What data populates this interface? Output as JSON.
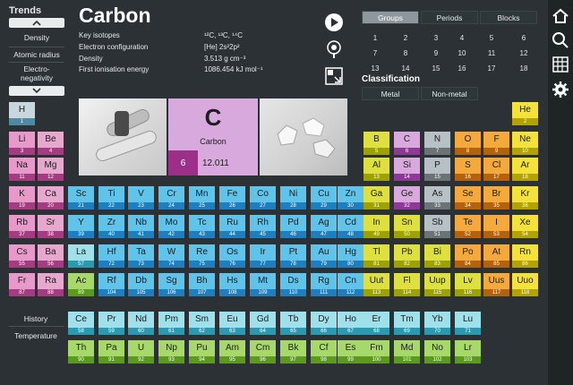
{
  "trends": {
    "title": "Trends",
    "items": [
      "Density",
      "Atomic radius",
      "Electro-\nnegativity"
    ]
  },
  "element": {
    "name": "Carbon",
    "symbol": "C",
    "display_name": "Carbon",
    "number": "6",
    "mass": "12.011",
    "properties": [
      {
        "label": "Key isotopes",
        "value": "¹²C, ¹³C, ¹⁴C"
      },
      {
        "label": "Electron configuration",
        "value": "[He] 2s²2p²"
      },
      {
        "label": "Density",
        "value": "3.513 g cm⁻³"
      },
      {
        "label": "First ionisation energy",
        "value": "1086.454 kJ mol⁻¹"
      }
    ]
  },
  "tabs": [
    "Groups",
    "Periods",
    "Blocks"
  ],
  "group_numbers": [
    "1",
    "2",
    "3",
    "4",
    "5",
    "6",
    "7",
    "8",
    "9",
    "10",
    "11",
    "12",
    "13",
    "14",
    "15",
    "16",
    "17",
    "18"
  ],
  "classification": {
    "title": "Classification",
    "options": [
      "Metal",
      "Non-metal"
    ]
  },
  "bottom_left": [
    "History",
    "Temperature"
  ],
  "colors": {
    "blue": "#5bc0eb",
    "purple": "#d7a9dc",
    "pink": "#e88fbe",
    "yellow": "#e3e34a",
    "lime": "#b4d44a",
    "orange": "#f6a94a",
    "gray": "#b8c0c4",
    "cyan": "#8cd9e6",
    "green": "#a5d86a"
  },
  "elements": [
    {
      "s": "H",
      "n": "1",
      "c": "#c8d6de",
      "b": "#4f8aa5"
    },
    {
      "s": "He",
      "n": "2",
      "c": "#f4e23a",
      "b": "#b2a300"
    },
    {
      "s": "Li",
      "n": "3",
      "c": "#e79ac9",
      "b": "#a33c80"
    },
    {
      "s": "Be",
      "n": "4",
      "c": "#e7a8cd",
      "b": "#a33c80"
    },
    {
      "s": "B",
      "n": "5",
      "c": "#dde03f",
      "b": "#9ea200"
    },
    {
      "s": "C",
      "n": "6",
      "c": "#d7a9dc",
      "b": "#8c3a96"
    },
    {
      "s": "N",
      "n": "7",
      "c": "#b7c0c4",
      "b": "#6b7377"
    },
    {
      "s": "O",
      "n": "8",
      "c": "#f4a93d",
      "b": "#b5620d"
    },
    {
      "s": "F",
      "n": "9",
      "c": "#f4a93d",
      "b": "#b5620d"
    },
    {
      "s": "Ne",
      "n": "10",
      "c": "#f4e23a",
      "b": "#b2a300"
    },
    {
      "s": "Na",
      "n": "11",
      "c": "#e79ac9",
      "b": "#a33c80"
    },
    {
      "s": "Mg",
      "n": "12",
      "c": "#e7a8cd",
      "b": "#a33c80"
    },
    {
      "s": "Al",
      "n": "13",
      "c": "#dde03f",
      "b": "#9ea200"
    },
    {
      "s": "Si",
      "n": "14",
      "c": "#d7a9dc",
      "b": "#8c3a96"
    },
    {
      "s": "P",
      "n": "15",
      "c": "#b7c0c4",
      "b": "#6b7377"
    },
    {
      "s": "S",
      "n": "16",
      "c": "#f4a93d",
      "b": "#b5620d"
    },
    {
      "s": "Cl",
      "n": "17",
      "c": "#f4a93d",
      "b": "#b5620d"
    },
    {
      "s": "Ar",
      "n": "18",
      "c": "#f4e23a",
      "b": "#b2a300"
    },
    {
      "s": "K",
      "n": "19",
      "c": "#e79ac9",
      "b": "#a33c80"
    },
    {
      "s": "Ca",
      "n": "20",
      "c": "#e7a8cd",
      "b": "#a33c80"
    },
    {
      "s": "Sc",
      "n": "21",
      "c": "#5fc3ea",
      "b": "#1d7fbf"
    },
    {
      "s": "Ti",
      "n": "22",
      "c": "#5fc3ea",
      "b": "#1d7fbf"
    },
    {
      "s": "V",
      "n": "23",
      "c": "#5fc3ea",
      "b": "#1d7fbf"
    },
    {
      "s": "Cr",
      "n": "24",
      "c": "#5fc3ea",
      "b": "#1d7fbf"
    },
    {
      "s": "Mn",
      "n": "25",
      "c": "#5fc3ea",
      "b": "#1d7fbf"
    },
    {
      "s": "Fe",
      "n": "26",
      "c": "#5fc3ea",
      "b": "#1d7fbf"
    },
    {
      "s": "Co",
      "n": "27",
      "c": "#5fc3ea",
      "b": "#1d7fbf"
    },
    {
      "s": "Ni",
      "n": "28",
      "c": "#5fc3ea",
      "b": "#1d7fbf"
    },
    {
      "s": "Cu",
      "n": "29",
      "c": "#5fc3ea",
      "b": "#1d7fbf"
    },
    {
      "s": "Zn",
      "n": "30",
      "c": "#5fc3ea",
      "b": "#1d7fbf"
    },
    {
      "s": "Ga",
      "n": "31",
      "c": "#dde03f",
      "b": "#9ea200"
    },
    {
      "s": "Ge",
      "n": "32",
      "c": "#d7a9dc",
      "b": "#8c3a96"
    },
    {
      "s": "As",
      "n": "33",
      "c": "#b7c0c4",
      "b": "#6b7377"
    },
    {
      "s": "Se",
      "n": "34",
      "c": "#f4a93d",
      "b": "#b5620d"
    },
    {
      "s": "Br",
      "n": "35",
      "c": "#f4a93d",
      "b": "#b5620d"
    },
    {
      "s": "Kr",
      "n": "36",
      "c": "#f4e23a",
      "b": "#b2a300"
    },
    {
      "s": "Rb",
      "n": "37",
      "c": "#e79ac9",
      "b": "#a33c80"
    },
    {
      "s": "Sr",
      "n": "38",
      "c": "#e7a8cd",
      "b": "#a33c80"
    },
    {
      "s": "Y",
      "n": "39",
      "c": "#5fc3ea",
      "b": "#1d7fbf"
    },
    {
      "s": "Zr",
      "n": "40",
      "c": "#5fc3ea",
      "b": "#1d7fbf"
    },
    {
      "s": "Nb",
      "n": "41",
      "c": "#5fc3ea",
      "b": "#1d7fbf"
    },
    {
      "s": "Mo",
      "n": "42",
      "c": "#5fc3ea",
      "b": "#1d7fbf"
    },
    {
      "s": "Tc",
      "n": "43",
      "c": "#5fc3ea",
      "b": "#1d7fbf"
    },
    {
      "s": "Ru",
      "n": "44",
      "c": "#5fc3ea",
      "b": "#1d7fbf"
    },
    {
      "s": "Rh",
      "n": "45",
      "c": "#5fc3ea",
      "b": "#1d7fbf"
    },
    {
      "s": "Pd",
      "n": "46",
      "c": "#5fc3ea",
      "b": "#1d7fbf"
    },
    {
      "s": "Ag",
      "n": "47",
      "c": "#5fc3ea",
      "b": "#1d7fbf"
    },
    {
      "s": "Cd",
      "n": "48",
      "c": "#5fc3ea",
      "b": "#1d7fbf"
    },
    {
      "s": "In",
      "n": "49",
      "c": "#dde03f",
      "b": "#9ea200"
    },
    {
      "s": "Sn",
      "n": "50",
      "c": "#dde03f",
      "b": "#9ea200"
    },
    {
      "s": "Sb",
      "n": "51",
      "c": "#b7c0c4",
      "b": "#6b7377"
    },
    {
      "s": "Te",
      "n": "52",
      "c": "#f4a93d",
      "b": "#b5620d"
    },
    {
      "s": "I",
      "n": "53",
      "c": "#f4a93d",
      "b": "#b5620d"
    },
    {
      "s": "Xe",
      "n": "54",
      "c": "#f4e23a",
      "b": "#b2a300"
    },
    {
      "s": "Cs",
      "n": "55",
      "c": "#e79ac9",
      "b": "#a33c80"
    },
    {
      "s": "Ba",
      "n": "56",
      "c": "#e7a8cd",
      "b": "#a33c80"
    },
    {
      "s": "La",
      "n": "57",
      "c": "#9fe0ea",
      "b": "#2a9ab0"
    },
    {
      "s": "Hf",
      "n": "72",
      "c": "#5fc3ea",
      "b": "#1d7fbf"
    },
    {
      "s": "Ta",
      "n": "73",
      "c": "#5fc3ea",
      "b": "#1d7fbf"
    },
    {
      "s": "W",
      "n": "74",
      "c": "#5fc3ea",
      "b": "#1d7fbf"
    },
    {
      "s": "Re",
      "n": "75",
      "c": "#5fc3ea",
      "b": "#1d7fbf"
    },
    {
      "s": "Os",
      "n": "76",
      "c": "#5fc3ea",
      "b": "#1d7fbf"
    },
    {
      "s": "Ir",
      "n": "77",
      "c": "#5fc3ea",
      "b": "#1d7fbf"
    },
    {
      "s": "Pt",
      "n": "78",
      "c": "#5fc3ea",
      "b": "#1d7fbf"
    },
    {
      "s": "Au",
      "n": "79",
      "c": "#5fc3ea",
      "b": "#1d7fbf"
    },
    {
      "s": "Hg",
      "n": "80",
      "c": "#5fc3ea",
      "b": "#1d7fbf"
    },
    {
      "s": "Tl",
      "n": "81",
      "c": "#dde03f",
      "b": "#9ea200"
    },
    {
      "s": "Pb",
      "n": "82",
      "c": "#dde03f",
      "b": "#9ea200"
    },
    {
      "s": "Bi",
      "n": "83",
      "c": "#dde03f",
      "b": "#9ea200"
    },
    {
      "s": "Po",
      "n": "84",
      "c": "#f4a93d",
      "b": "#b5620d"
    },
    {
      "s": "At",
      "n": "85",
      "c": "#f4a93d",
      "b": "#b5620d"
    },
    {
      "s": "Rn",
      "n": "86",
      "c": "#f4e23a",
      "b": "#b2a300"
    },
    {
      "s": "Fr",
      "n": "87",
      "c": "#e79ac9",
      "b": "#a33c80"
    },
    {
      "s": "Ra",
      "n": "88",
      "c": "#e7a8cd",
      "b": "#a33c80"
    },
    {
      "s": "Ac",
      "n": "89",
      "c": "#a6d86a",
      "b": "#5c9a1e"
    },
    {
      "s": "Rf",
      "n": "104",
      "c": "#5fc3ea",
      "b": "#1d7fbf"
    },
    {
      "s": "Db",
      "n": "105",
      "c": "#5fc3ea",
      "b": "#1d7fbf"
    },
    {
      "s": "Sg",
      "n": "106",
      "c": "#5fc3ea",
      "b": "#1d7fbf"
    },
    {
      "s": "Bh",
      "n": "107",
      "c": "#5fc3ea",
      "b": "#1d7fbf"
    },
    {
      "s": "Hs",
      "n": "108",
      "c": "#5fc3ea",
      "b": "#1d7fbf"
    },
    {
      "s": "Mt",
      "n": "109",
      "c": "#5fc3ea",
      "b": "#1d7fbf"
    },
    {
      "s": "Ds",
      "n": "110",
      "c": "#5fc3ea",
      "b": "#1d7fbf"
    },
    {
      "s": "Rg",
      "n": "111",
      "c": "#5fc3ea",
      "b": "#1d7fbf"
    },
    {
      "s": "Cn",
      "n": "112",
      "c": "#5fc3ea",
      "b": "#1d7fbf"
    },
    {
      "s": "Uut",
      "n": "113",
      "c": "#dde03f",
      "b": "#9ea200"
    },
    {
      "s": "Fl",
      "n": "114",
      "c": "#dde03f",
      "b": "#9ea200"
    },
    {
      "s": "Uup",
      "n": "115",
      "c": "#dde03f",
      "b": "#9ea200"
    },
    {
      "s": "Lv",
      "n": "116",
      "c": "#dde03f",
      "b": "#9ea200"
    },
    {
      "s": "Uus",
      "n": "117",
      "c": "#f4a93d",
      "b": "#b5620d"
    },
    {
      "s": "Uuo",
      "n": "118",
      "c": "#f4e23a",
      "b": "#b2a300"
    },
    {
      "s": "Ce",
      "n": "58",
      "c": "#9fe0ea",
      "b": "#2a9ab0"
    },
    {
      "s": "Pr",
      "n": "59",
      "c": "#9fe0ea",
      "b": "#2a9ab0"
    },
    {
      "s": "Nd",
      "n": "60",
      "c": "#9fe0ea",
      "b": "#2a9ab0"
    },
    {
      "s": "Pm",
      "n": "61",
      "c": "#9fe0ea",
      "b": "#2a9ab0"
    },
    {
      "s": "Sm",
      "n": "62",
      "c": "#9fe0ea",
      "b": "#2a9ab0"
    },
    {
      "s": "Eu",
      "n": "63",
      "c": "#9fe0ea",
      "b": "#2a9ab0"
    },
    {
      "s": "Gd",
      "n": "64",
      "c": "#9fe0ea",
      "b": "#2a9ab0"
    },
    {
      "s": "Tb",
      "n": "65",
      "c": "#9fe0ea",
      "b": "#2a9ab0"
    },
    {
      "s": "Dy",
      "n": "66",
      "c": "#9fe0ea",
      "b": "#2a9ab0"
    },
    {
      "s": "Ho",
      "n": "67",
      "c": "#9fe0ea",
      "b": "#2a9ab0"
    },
    {
      "s": "Er",
      "n": "68",
      "c": "#9fe0ea",
      "b": "#2a9ab0"
    },
    {
      "s": "Tm",
      "n": "69",
      "c": "#9fe0ea",
      "b": "#2a9ab0"
    },
    {
      "s": "Yb",
      "n": "70",
      "c": "#9fe0ea",
      "b": "#2a9ab0"
    },
    {
      "s": "Lu",
      "n": "71",
      "c": "#9fe0ea",
      "b": "#2a9ab0"
    },
    {
      "s": "Th",
      "n": "90",
      "c": "#a6d86a",
      "b": "#5c9a1e"
    },
    {
      "s": "Pa",
      "n": "91",
      "c": "#a6d86a",
      "b": "#5c9a1e"
    },
    {
      "s": "U",
      "n": "92",
      "c": "#a6d86a",
      "b": "#5c9a1e"
    },
    {
      "s": "Np",
      "n": "93",
      "c": "#a6d86a",
      "b": "#5c9a1e"
    },
    {
      "s": "Pu",
      "n": "94",
      "c": "#a6d86a",
      "b": "#5c9a1e"
    },
    {
      "s": "Am",
      "n": "95",
      "c": "#a6d86a",
      "b": "#5c9a1e"
    },
    {
      "s": "Cm",
      "n": "96",
      "c": "#a6d86a",
      "b": "#5c9a1e"
    },
    {
      "s": "Bk",
      "n": "97",
      "c": "#a6d86a",
      "b": "#5c9a1e"
    },
    {
      "s": "Cf",
      "n": "98",
      "c": "#a6d86a",
      "b": "#5c9a1e"
    },
    {
      "s": "Es",
      "n": "99",
      "c": "#a6d86a",
      "b": "#5c9a1e"
    },
    {
      "s": "Fm",
      "n": "100",
      "c": "#a6d86a",
      "b": "#5c9a1e"
    },
    {
      "s": "Md",
      "n": "101",
      "c": "#a6d86a",
      "b": "#5c9a1e"
    },
    {
      "s": "No",
      "n": "102",
      "c": "#a6d86a",
      "b": "#5c9a1e"
    },
    {
      "s": "Lr",
      "n": "103",
      "c": "#a6d86a",
      "b": "#5c9a1e"
    }
  ]
}
